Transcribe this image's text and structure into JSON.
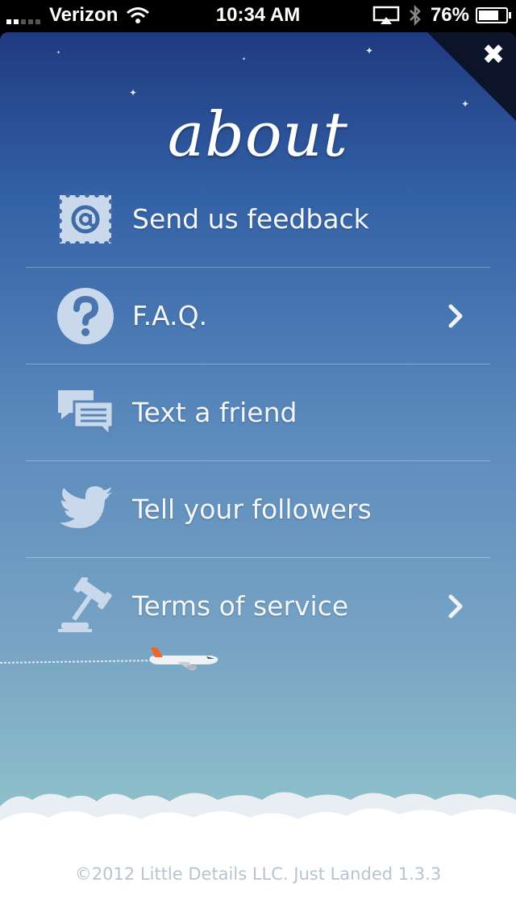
{
  "status_bar": {
    "carrier": "Verizon",
    "time": "10:34 AM",
    "battery_percent_label": "76%",
    "battery_level": 0.76,
    "signal_bars_on": 2,
    "signal_bars_total": 5,
    "icons": [
      "signal-bars-icon",
      "wifi-icon",
      "airplay-icon",
      "bluetooth-icon",
      "battery-icon"
    ]
  },
  "header": {
    "title": "about",
    "close_icon": "close-icon"
  },
  "menu": {
    "items": [
      {
        "label": "Send us feedback",
        "icon": "mail-stamp-icon",
        "has_chevron": false
      },
      {
        "label": "F.A.Q.",
        "icon": "question-icon",
        "has_chevron": true
      },
      {
        "label": "Text a friend",
        "icon": "chat-bubbles-icon",
        "has_chevron": false
      },
      {
        "label": "Tell your followers",
        "icon": "twitter-bird-icon",
        "has_chevron": false
      },
      {
        "label": "Terms of service",
        "icon": "gavel-icon",
        "has_chevron": true
      }
    ]
  },
  "footer": {
    "text": "©2012 Little Details LLC. Just Landed 1.3.3"
  },
  "colors": {
    "sky_top": "#1f3a82",
    "sky_bottom": "#a5d2d2",
    "icon_fill": "#c9d8ea",
    "text": "#f4f7fb",
    "footer_text": "#b7c4cf"
  }
}
